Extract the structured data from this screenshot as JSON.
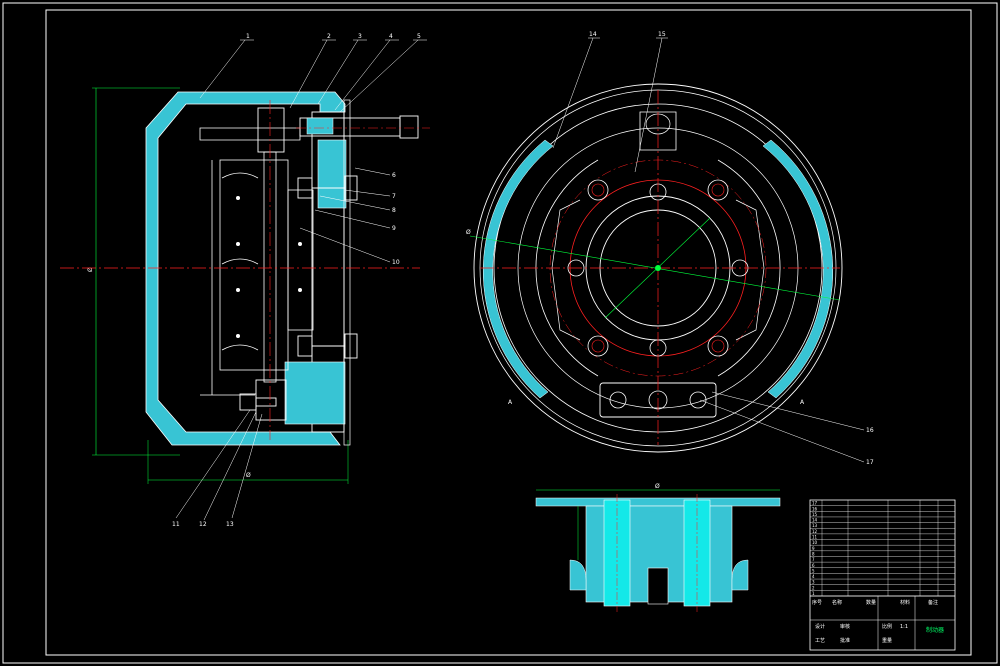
{
  "drawing": {
    "title_block_name": "制动器",
    "colors": {
      "outline": "#ffffff",
      "section_fill": "#38c4d4",
      "center_line": "#ff2020",
      "dimension": "#00ff3c",
      "leader": "#ffffff",
      "hatch": "#38c4d4",
      "bore_fill": "#14e8e8",
      "frame": "#ffffff",
      "background": "#000000"
    },
    "callouts_left_top": [
      "1",
      "2",
      "3",
      "4",
      "5"
    ],
    "callouts_left_side": [
      "6",
      "7",
      "8",
      "9",
      "10"
    ],
    "callouts_left_bottom": [
      "11",
      "12",
      "13"
    ],
    "callouts_right_top": [
      "14",
      "15"
    ],
    "callouts_right_side": [
      "16",
      "17"
    ],
    "dim_left_vertical": "Ø",
    "dim_left_horizontal": "Ø",
    "dim_right_diameter": "Ø",
    "dim_section_top": "Ø",
    "section_markers": [
      "A",
      "A"
    ],
    "title_block": {
      "rows": [
        "17",
        "16",
        "15",
        "14",
        "13",
        "12",
        "11",
        "10",
        "9",
        "8",
        "7",
        "6",
        "5",
        "4",
        "3",
        "2",
        "1"
      ],
      "header": [
        "序号",
        "名称",
        "数量",
        "材料",
        "备注"
      ],
      "footer_left": [
        "设计",
        "审核",
        "工艺",
        "批准"
      ],
      "footer_mid": [
        "比例",
        "重量"
      ],
      "footer_scale": "1:1"
    }
  }
}
